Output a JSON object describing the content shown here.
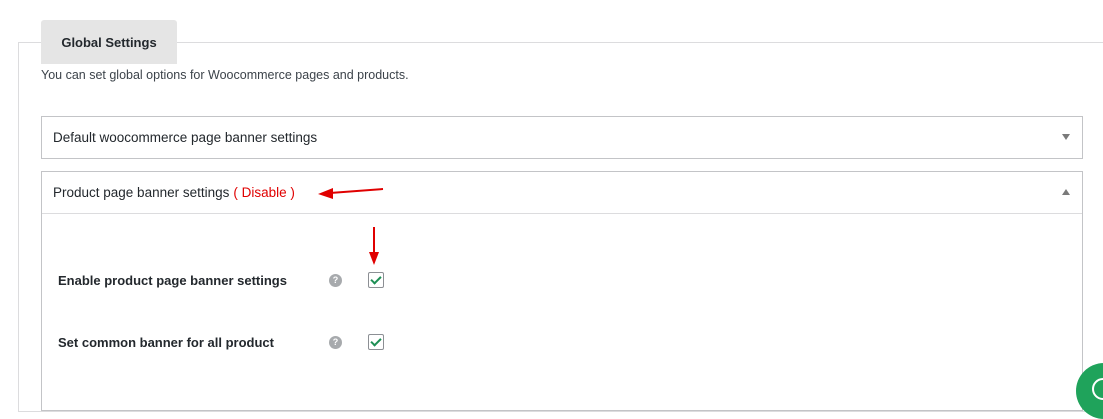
{
  "tab": {
    "label": "Global Settings"
  },
  "description": "You can set global options for Woocommerce pages and products.",
  "accordions": [
    {
      "title": "Default woocommerce page banner settings",
      "expanded": false
    },
    {
      "title": "Product page banner settings",
      "status": "( Disable )",
      "expanded": true
    }
  ],
  "settings": [
    {
      "label": "Enable product page banner settings",
      "help": "?",
      "checked": true
    },
    {
      "label": "Set common banner for all product",
      "help": "?",
      "checked": true
    }
  ],
  "colors": {
    "status_red": "#e00000",
    "check_green": "#1e8f55",
    "chat_green": "#1fa35b"
  }
}
